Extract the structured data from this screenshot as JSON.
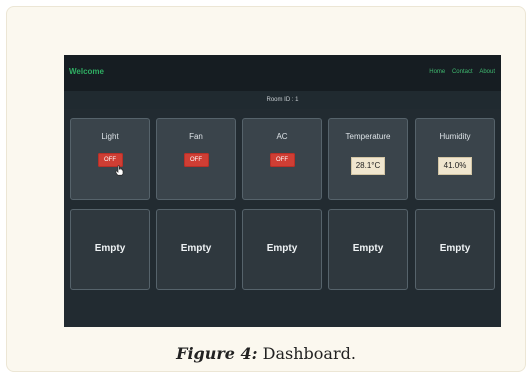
{
  "navbar": {
    "brand": "Welcome",
    "links": [
      "Home",
      "Contact",
      "About"
    ]
  },
  "room": {
    "label": "Room ID : 1"
  },
  "devices": [
    {
      "label": "Light",
      "button": "OFF",
      "state": "off"
    },
    {
      "label": "Fan",
      "button": "OFF",
      "state": "off"
    },
    {
      "label": "AC",
      "button": "OFF",
      "state": "off"
    }
  ],
  "sensors": [
    {
      "label": "Temperature",
      "value": "28.1°C"
    },
    {
      "label": "Humidity",
      "value": "41.0%"
    }
  ],
  "empty_slots": [
    "Empty",
    "Empty",
    "Empty",
    "Empty",
    "Empty"
  ],
  "caption": {
    "figure": "Figure 4:",
    "text": " Dashboard."
  },
  "colors": {
    "toggle_off": "#cf3e34",
    "brand": "#2fae63",
    "panel": "#3a444b"
  }
}
